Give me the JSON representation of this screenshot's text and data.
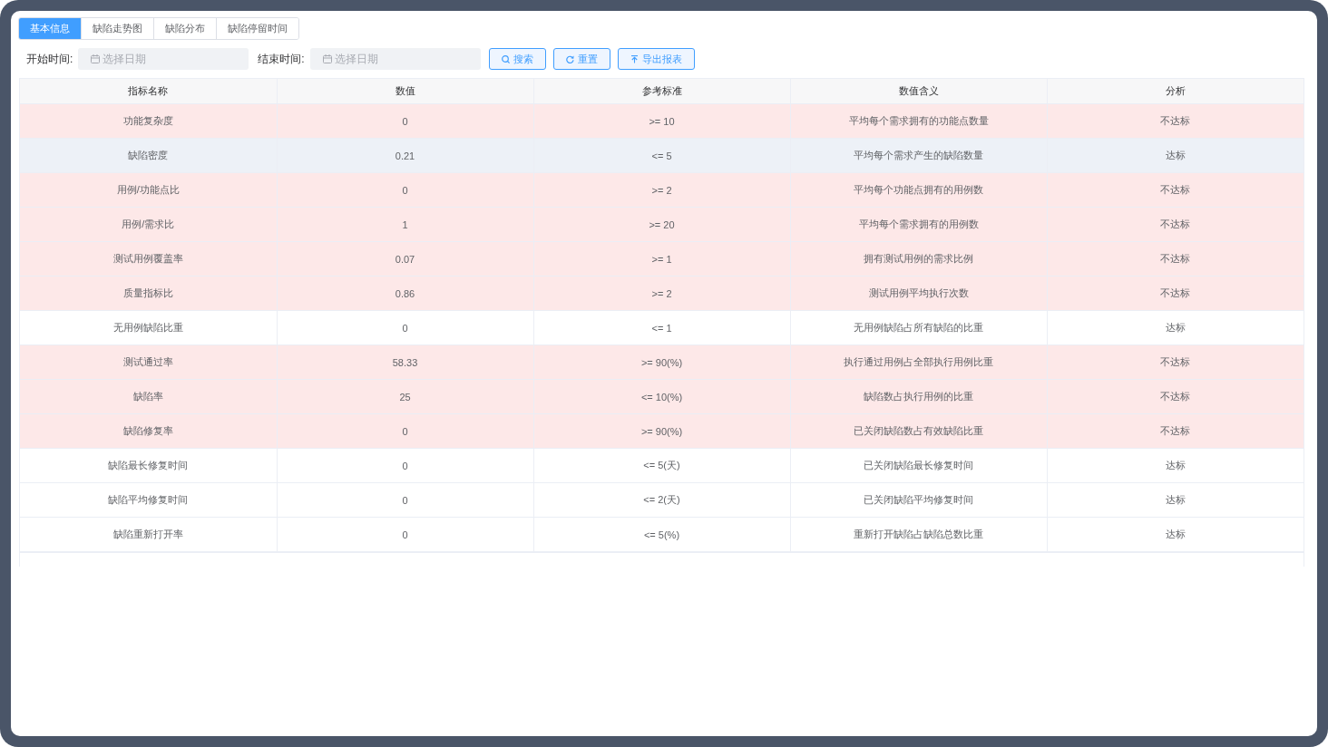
{
  "tabs": [
    {
      "label": "基本信息",
      "selected": true
    },
    {
      "label": "缺陷走势图",
      "selected": false
    },
    {
      "label": "缺陷分布",
      "selected": false
    },
    {
      "label": "缺陷停留时间",
      "selected": false
    }
  ],
  "filters": [
    {
      "label": "开始时间:",
      "placeholder": "选择日期"
    },
    {
      "label": "结束时间:",
      "placeholder": "选择日期"
    }
  ],
  "buttons": [
    {
      "label": "搜索",
      "kind": "search"
    },
    {
      "label": "重置",
      "kind": "reset"
    },
    {
      "label": "导出报表",
      "kind": "export"
    }
  ],
  "table": {
    "columns": [
      "指标名称",
      "数值",
      "参考标准",
      "数值含义",
      "分析"
    ],
    "rows": [
      {
        "cells": [
          "功能复杂度",
          "0",
          ">= 10",
          "平均每个需求拥有的功能点数量",
          "不达标"
        ],
        "failed": true,
        "hovered": false
      },
      {
        "cells": [
          "缺陷密度",
          "0.21",
          "<= 5",
          "平均每个需求产生的缺陷数量",
          "达标"
        ],
        "failed": false,
        "hovered": true
      },
      {
        "cells": [
          "用例/功能点比",
          "0",
          ">= 2",
          "平均每个功能点拥有的用例数",
          "不达标"
        ],
        "failed": true,
        "hovered": false
      },
      {
        "cells": [
          "用例/需求比",
          "1",
          ">= 20",
          "平均每个需求拥有的用例数",
          "不达标"
        ],
        "failed": true,
        "hovered": false
      },
      {
        "cells": [
          "测试用例覆盖率",
          "0.07",
          ">= 1",
          "拥有测试用例的需求比例",
          "不达标"
        ],
        "failed": true,
        "hovered": false
      },
      {
        "cells": [
          "质量指标比",
          "0.86",
          ">= 2",
          "测试用例平均执行次数",
          "不达标"
        ],
        "failed": true,
        "hovered": false
      },
      {
        "cells": [
          "无用例缺陷比重",
          "0",
          "<= 1",
          "无用例缺陷占所有缺陷的比重",
          "达标"
        ],
        "failed": false,
        "hovered": false
      },
      {
        "cells": [
          "测试通过率",
          "58.33",
          ">= 90(%)",
          "执行通过用例占全部执行用例比重",
          "不达标"
        ],
        "failed": true,
        "hovered": false
      },
      {
        "cells": [
          "缺陷率",
          "25",
          "<= 10(%)",
          "缺陷数占执行用例的比重",
          "不达标"
        ],
        "failed": true,
        "hovered": false
      },
      {
        "cells": [
          "缺陷修复率",
          "0",
          ">= 90(%)",
          "已关闭缺陷数占有效缺陷比重",
          "不达标"
        ],
        "failed": true,
        "hovered": false
      },
      {
        "cells": [
          "缺陷最长修复时间",
          "0",
          "<= 5(天)",
          "已关闭缺陷最长修复时间",
          "达标"
        ],
        "failed": false,
        "hovered": false
      },
      {
        "cells": [
          "缺陷平均修复时间",
          "0",
          "<= 2(天)",
          "已关闭缺陷平均修复时间",
          "达标"
        ],
        "failed": false,
        "hovered": false
      },
      {
        "cells": [
          "缺陷重新打开率",
          "0",
          "<= 5(%)",
          "重新打开缺陷占缺陷总数比重",
          "达标"
        ],
        "failed": false,
        "hovered": false
      }
    ]
  }
}
